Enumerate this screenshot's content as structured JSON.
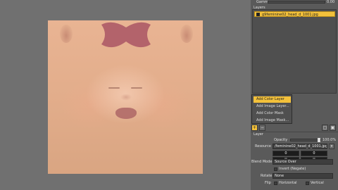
{
  "panel": {
    "gamma_label": "Gamma",
    "gamma_value": "0.00",
    "layers_label": "Layers",
    "layer_name": "g9feminine02_head_d_1001.jpg",
    "layer_section_label": "Layer",
    "opacity_label": "Opacity",
    "opacity_value": "100.0%",
    "opacity_level": 1.0,
    "resource_label": "Resource",
    "resource_value": "/feminine02_head_d_1001.jpg",
    "num1": "0",
    "num2": "0",
    "num3": "0",
    "num4": "0",
    "blend_label": "Blend Mode",
    "blend_value": "Source Over",
    "invert_label": "Invert (Negate)",
    "rotate_label": "Rotate",
    "rotate_value": "None",
    "flip_label": "Flip",
    "flip_h": "Horizontal",
    "flip_v": "Vertical",
    "add_btn": "+",
    "remove_btn": "−"
  },
  "menu": {
    "items": [
      "Add Color Layer",
      "Add Image Layer...",
      "Add Color Mask",
      "Add Image Mask..."
    ]
  },
  "colors": {
    "accent": "#f3c13b",
    "panel": "#5a5a5a",
    "scalp": "#b3636b"
  }
}
